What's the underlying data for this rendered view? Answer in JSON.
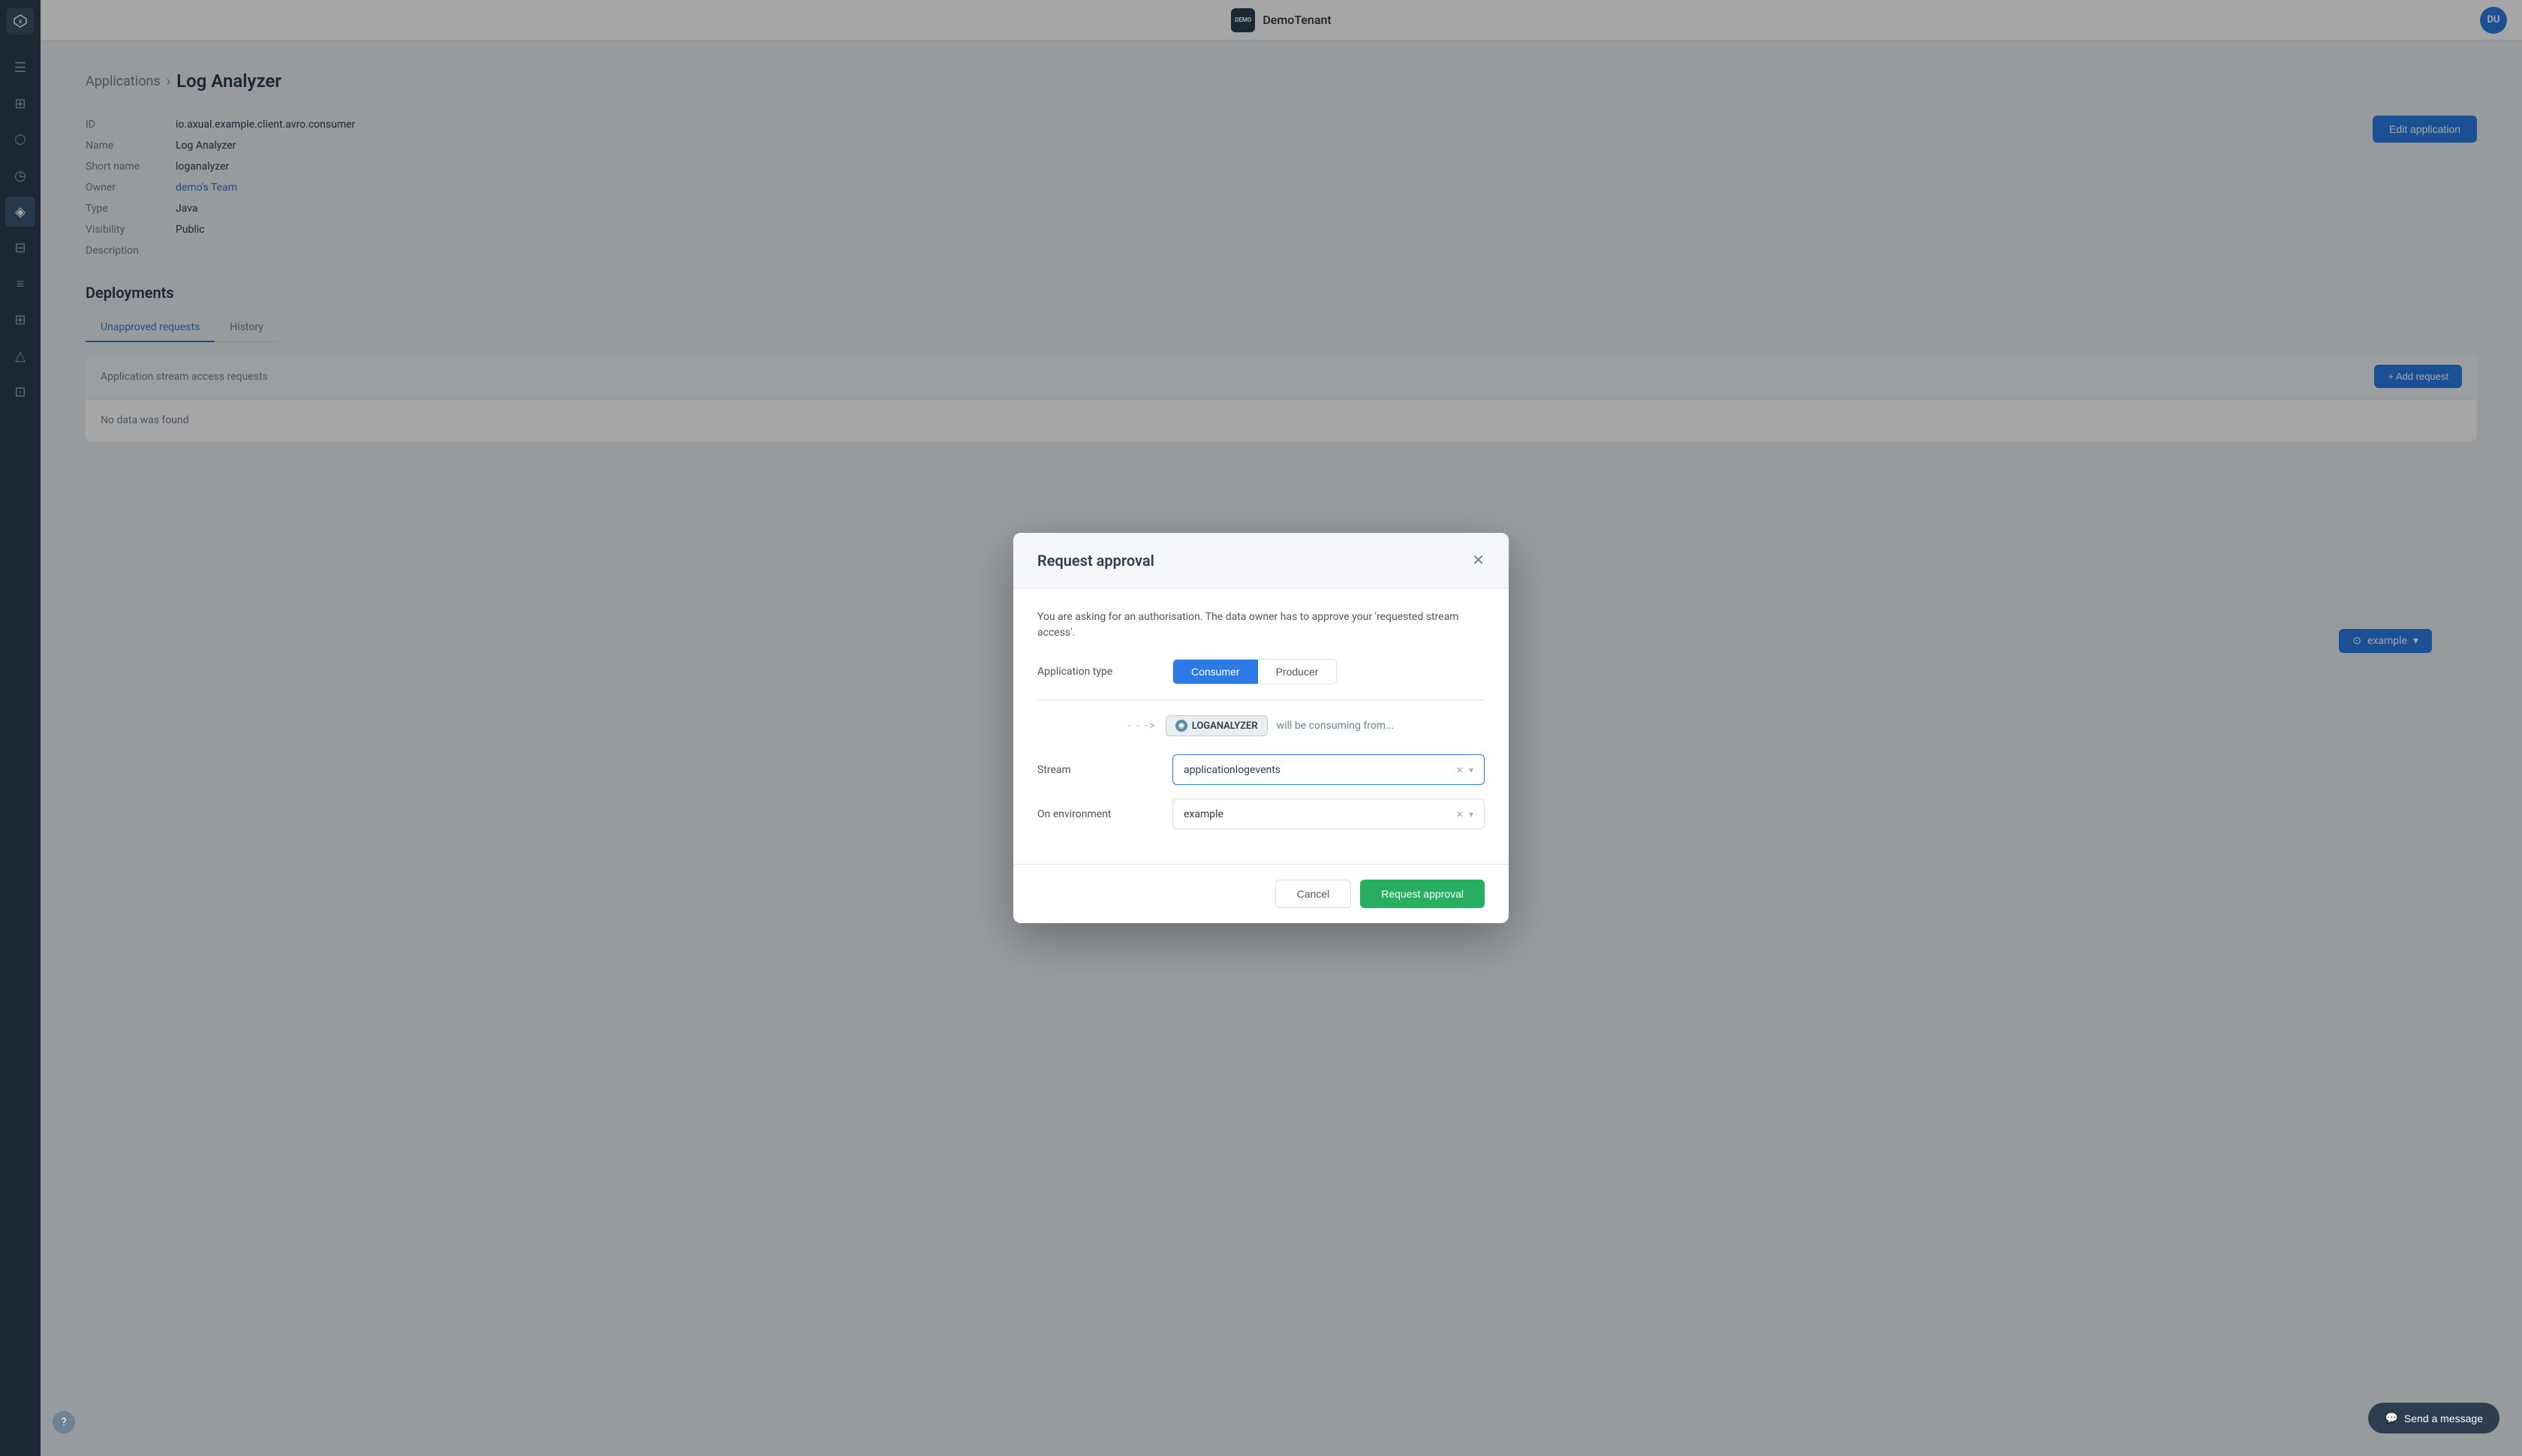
{
  "topbar": {
    "logo_text": "DEMO",
    "title": "DemoTenant",
    "avatar_text": "DU"
  },
  "breadcrumb": {
    "parent": "Applications",
    "separator": "›",
    "current": "Log Analyzer"
  },
  "app_details": {
    "id_label": "ID",
    "id_value": "io.axual.example.client.avro.consumer",
    "name_label": "Name",
    "name_value": "Log Analyzer",
    "short_name_label": "Short name",
    "short_name_value": "loganalyzer",
    "owner_label": "Owner",
    "owner_value": "demo's Team",
    "type_label": "Type",
    "type_value": "Java",
    "visibility_label": "Visibility",
    "visibility_value": "Public",
    "description_label": "Description",
    "description_value": ""
  },
  "edit_button_label": "Edit application",
  "deployments": {
    "title": "Deployments",
    "environment_badge": "example"
  },
  "tabs": {
    "unapproved_label": "Unapproved requests",
    "history_label": "History"
  },
  "requests_panel": {
    "header": "Application stream access requests",
    "no_data": "No data was found",
    "add_button": "+ Add request"
  },
  "modal": {
    "title": "Request approval",
    "info_text": "You are asking for an authorisation. The data owner has to approve your 'requested stream access'.",
    "app_type_label": "Application type",
    "consumer_label": "Consumer",
    "producer_label": "Producer",
    "flow_app": "LOGANALYZER",
    "flow_text": "will be consuming from...",
    "stream_label": "Stream",
    "stream_value": "applicationlogevents",
    "env_label": "On environment",
    "env_value": "example",
    "cancel_label": "Cancel",
    "approve_label": "Request approval"
  },
  "chat_button": "Send a message",
  "help_icon": "?"
}
